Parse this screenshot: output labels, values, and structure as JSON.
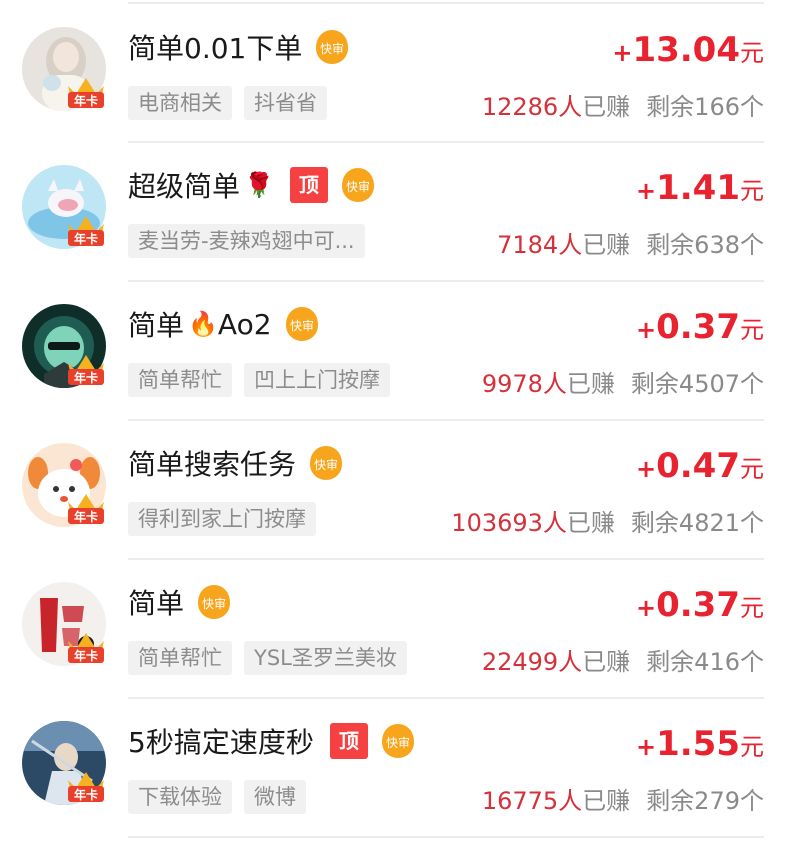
{
  "tasks": [
    {
      "title": "简单0.01下单",
      "emoji": "",
      "has_top": false,
      "fast_label": "快审",
      "tags": [
        "电商相关",
        "抖省省"
      ],
      "plus": "+",
      "amount": "13.04",
      "unit": "元",
      "earned_count": "12286人",
      "earned_text": "已赚",
      "remaining": "剩余166个",
      "badge": "年卡"
    },
    {
      "title": "超级简单",
      "emoji": "🌹",
      "has_top": true,
      "top_label": "顶",
      "fast_label": "快审",
      "tags": [
        "麦当劳-麦辣鸡翅中可..."
      ],
      "plus": "+",
      "amount": "1.41",
      "unit": "元",
      "earned_count": "7184人",
      "earned_text": "已赚",
      "remaining": "剩余638个",
      "badge": "年卡"
    },
    {
      "title": "简单",
      "emoji": "🔥",
      "title_suffix": "Ao2",
      "has_top": false,
      "fast_label": "快审",
      "tags": [
        "简单帮忙",
        "凹上上门按摩"
      ],
      "plus": "+",
      "amount": "0.37",
      "unit": "元",
      "earned_count": "9978人",
      "earned_text": "已赚",
      "remaining": "剩余4507个",
      "badge": "年卡"
    },
    {
      "title": "简单搜索任务",
      "emoji": "",
      "has_top": false,
      "fast_label": "快审",
      "tags": [
        "得利到家上门按摩"
      ],
      "plus": "+",
      "amount": "0.47",
      "unit": "元",
      "earned_count": "103693人",
      "earned_text": "已赚",
      "remaining": "剩余4821个",
      "badge": "年卡"
    },
    {
      "title": "简单",
      "emoji": "",
      "has_top": false,
      "fast_label": "快审",
      "tags": [
        "简单帮忙",
        "YSL圣罗兰美妆"
      ],
      "plus": "+",
      "amount": "0.37",
      "unit": "元",
      "earned_count": "22499人",
      "earned_text": "已赚",
      "remaining": "剩余416个",
      "badge": "年卡"
    },
    {
      "title": "5秒搞定速度秒",
      "emoji": "",
      "has_top": true,
      "top_label": "顶",
      "fast_label": "快审",
      "tags": [
        "下载体验",
        "微博"
      ],
      "plus": "+",
      "amount": "1.55",
      "unit": "元",
      "earned_count": "16775人",
      "earned_text": "已赚",
      "remaining": "剩余279个",
      "badge": "年卡"
    }
  ],
  "colors": {
    "reward": "#e8222f",
    "earned": "#d5313a",
    "fast_badge": "#f5a623",
    "top_badge": "#f54141"
  }
}
